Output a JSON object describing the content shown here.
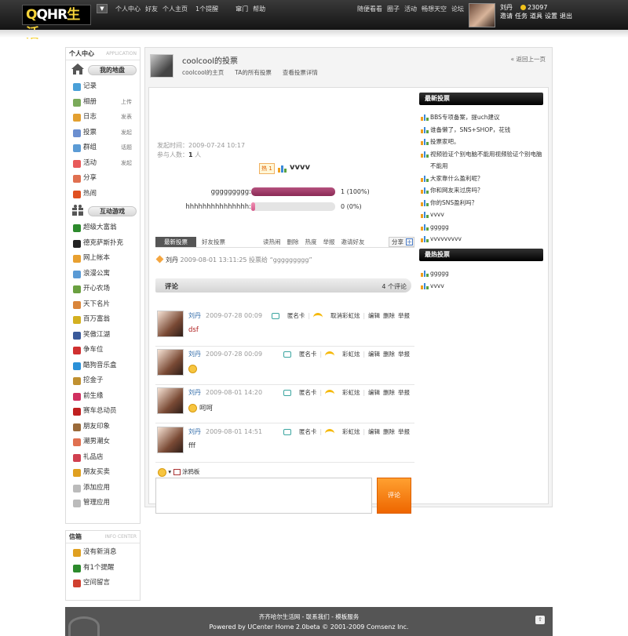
{
  "top": {
    "logo_q": "Q",
    "logo_mid": "QHR",
    "logo_cn": "生活",
    "nav_left": [
      "个人中心",
      "好友",
      "个人主页",
      "1个提醒",
      "窜门",
      "帮助"
    ],
    "nav_right": [
      "随便看看",
      "圈子",
      "活动",
      "畅想天空",
      "论坛"
    ],
    "username": "刘丹",
    "credits": "23097",
    "user_links": [
      "邀请",
      "任务",
      "道具",
      "设置",
      "退出"
    ]
  },
  "sidebar": {
    "title": "个人中心",
    "title_en": "APPLICATION",
    "group1": "我的地盘",
    "items": [
      {
        "label": "记录",
        "extra": "",
        "color": "#4aa0d8"
      },
      {
        "label": "相册",
        "extra": "上传",
        "color": "#7aaa5a"
      },
      {
        "label": "日志",
        "extra": "发表",
        "color": "#e3a030"
      },
      {
        "label": "投票",
        "extra": "发起",
        "color": "#6b8fd0"
      },
      {
        "label": "群组",
        "extra": "话题",
        "color": "#5b9bd5"
      },
      {
        "label": "活动",
        "extra": "发起",
        "color": "#e85a5a"
      },
      {
        "label": "分享",
        "extra": "",
        "color": "#e07050"
      },
      {
        "label": "热闹",
        "extra": "",
        "color": "#e05020"
      }
    ],
    "group2": "互动游戏",
    "games": [
      {
        "label": "超级大富翁",
        "color": "#2c8a2c"
      },
      {
        "label": "德克萨斯扑克",
        "color": "#222222"
      },
      {
        "label": "网上帐本",
        "color": "#e8a030"
      },
      {
        "label": "浪漫公寓",
        "color": "#5a9ad5"
      },
      {
        "label": "开心农场",
        "color": "#6aa040"
      },
      {
        "label": "天下名片",
        "color": "#d9853a"
      },
      {
        "label": "百万富翁",
        "color": "#d4b020"
      },
      {
        "label": "笑傲江湖",
        "color": "#3a5a9a"
      },
      {
        "label": "争车位",
        "color": "#d03030"
      },
      {
        "label": "酷狗音乐盒",
        "color": "#2a90d8"
      },
      {
        "label": "挖金子",
        "color": "#c09030"
      },
      {
        "label": "前生缘",
        "color": "#d03060"
      },
      {
        "label": "赛车总动员",
        "color": "#c02020"
      },
      {
        "label": "朋友印象",
        "color": "#9a6a3a"
      },
      {
        "label": "潮男潮女",
        "color": "#e07050"
      },
      {
        "label": "礼品店",
        "color": "#d04050"
      },
      {
        "label": "朋友买卖",
        "color": "#e0a020"
      },
      {
        "label": "添加应用",
        "color": "#bbbbbb"
      },
      {
        "label": "管理应用",
        "color": "#bbbbbb"
      }
    ]
  },
  "mailbox": {
    "title": "信箱",
    "title_en": "INFO CENTER",
    "items": [
      {
        "label": "没有新消息",
        "color": "#e0a020"
      },
      {
        "label": "有1个提醒",
        "color": "#2c8a2c"
      },
      {
        "label": "空间留言",
        "color": "#d04030"
      }
    ]
  },
  "header": {
    "title": "coolcool的投票",
    "crumbs": [
      "coolcool的主页",
      "TA的所有投票",
      "查看投票详情"
    ],
    "back": "« 返回上一页"
  },
  "poll": {
    "time": "发起时间：2009-07-24 10:17",
    "participants_label": "参与人数：",
    "participants": "1",
    "participants_unit": " 人",
    "hot": "热 1",
    "title": "vvvv",
    "options": [
      {
        "label": "ggggggggg:",
        "result": "1 (100%)",
        "fill": 1.0
      },
      {
        "label": "hhhhhhhhhhhhhhh:",
        "result": "0 (0%)",
        "fill": 0.0
      }
    ]
  },
  "tabs": {
    "active": "最新投票",
    "second": "好友投票",
    "links": [
      "读热闹",
      "删除",
      "热度",
      "举报",
      "邀请好友"
    ],
    "share": "分享"
  },
  "feed": {
    "name": "刘丹",
    "text": " 2009-08-01 13:11:25 投票给 “ggggggggg”"
  },
  "comments": {
    "title": "评论",
    "count": "4 个评论",
    "card": "匿名卡",
    "edit": "编辑",
    "delete": "删除",
    "report": "举报",
    "list": [
      {
        "name": "刘丹",
        "time": "2009-07-28 00:09",
        "rainbow": "取消彩虹炫",
        "text": "dsf",
        "emoji": false
      },
      {
        "name": "刘丹",
        "time": "2009-07-28 00:09",
        "rainbow": "彩虹炫",
        "text": "",
        "emoji": true
      },
      {
        "name": "刘丹",
        "time": "2009-08-01 14:20",
        "rainbow": "彩虹炫",
        "text": "呵呵",
        "emoji": true
      },
      {
        "name": "刘丹",
        "time": "2009-08-01 14:51",
        "rainbow": "彩虹炫",
        "text": "fff",
        "emoji": false
      }
    ],
    "scribble": "涂鸦板",
    "submit": "评论"
  },
  "latest": {
    "title": "最新投票",
    "items": [
      "BBS专项备案，提uch建议",
      "谁备懒了，SNS+SHOP，花钱",
      "投票家吧。",
      "视频验证个别电脑不能用视频验证个别电脑不能用",
      "大家靠什么盈利呢？",
      "你和网友来过房吗？",
      "你的SNS盈利吗？",
      "vvvv",
      "ggggg",
      "vvvvvvvvv"
    ]
  },
  "hottest": {
    "title": "最热投票",
    "items": [
      "ggggg",
      "vvvv"
    ]
  },
  "footer": {
    "line1": "齐齐哈尔生活网 - 联系我们 - 模板服务",
    "line2": "Powered by UCenter Home 2.0beta © 2001-2009 Comsenz Inc.",
    "up": "⇧"
  }
}
